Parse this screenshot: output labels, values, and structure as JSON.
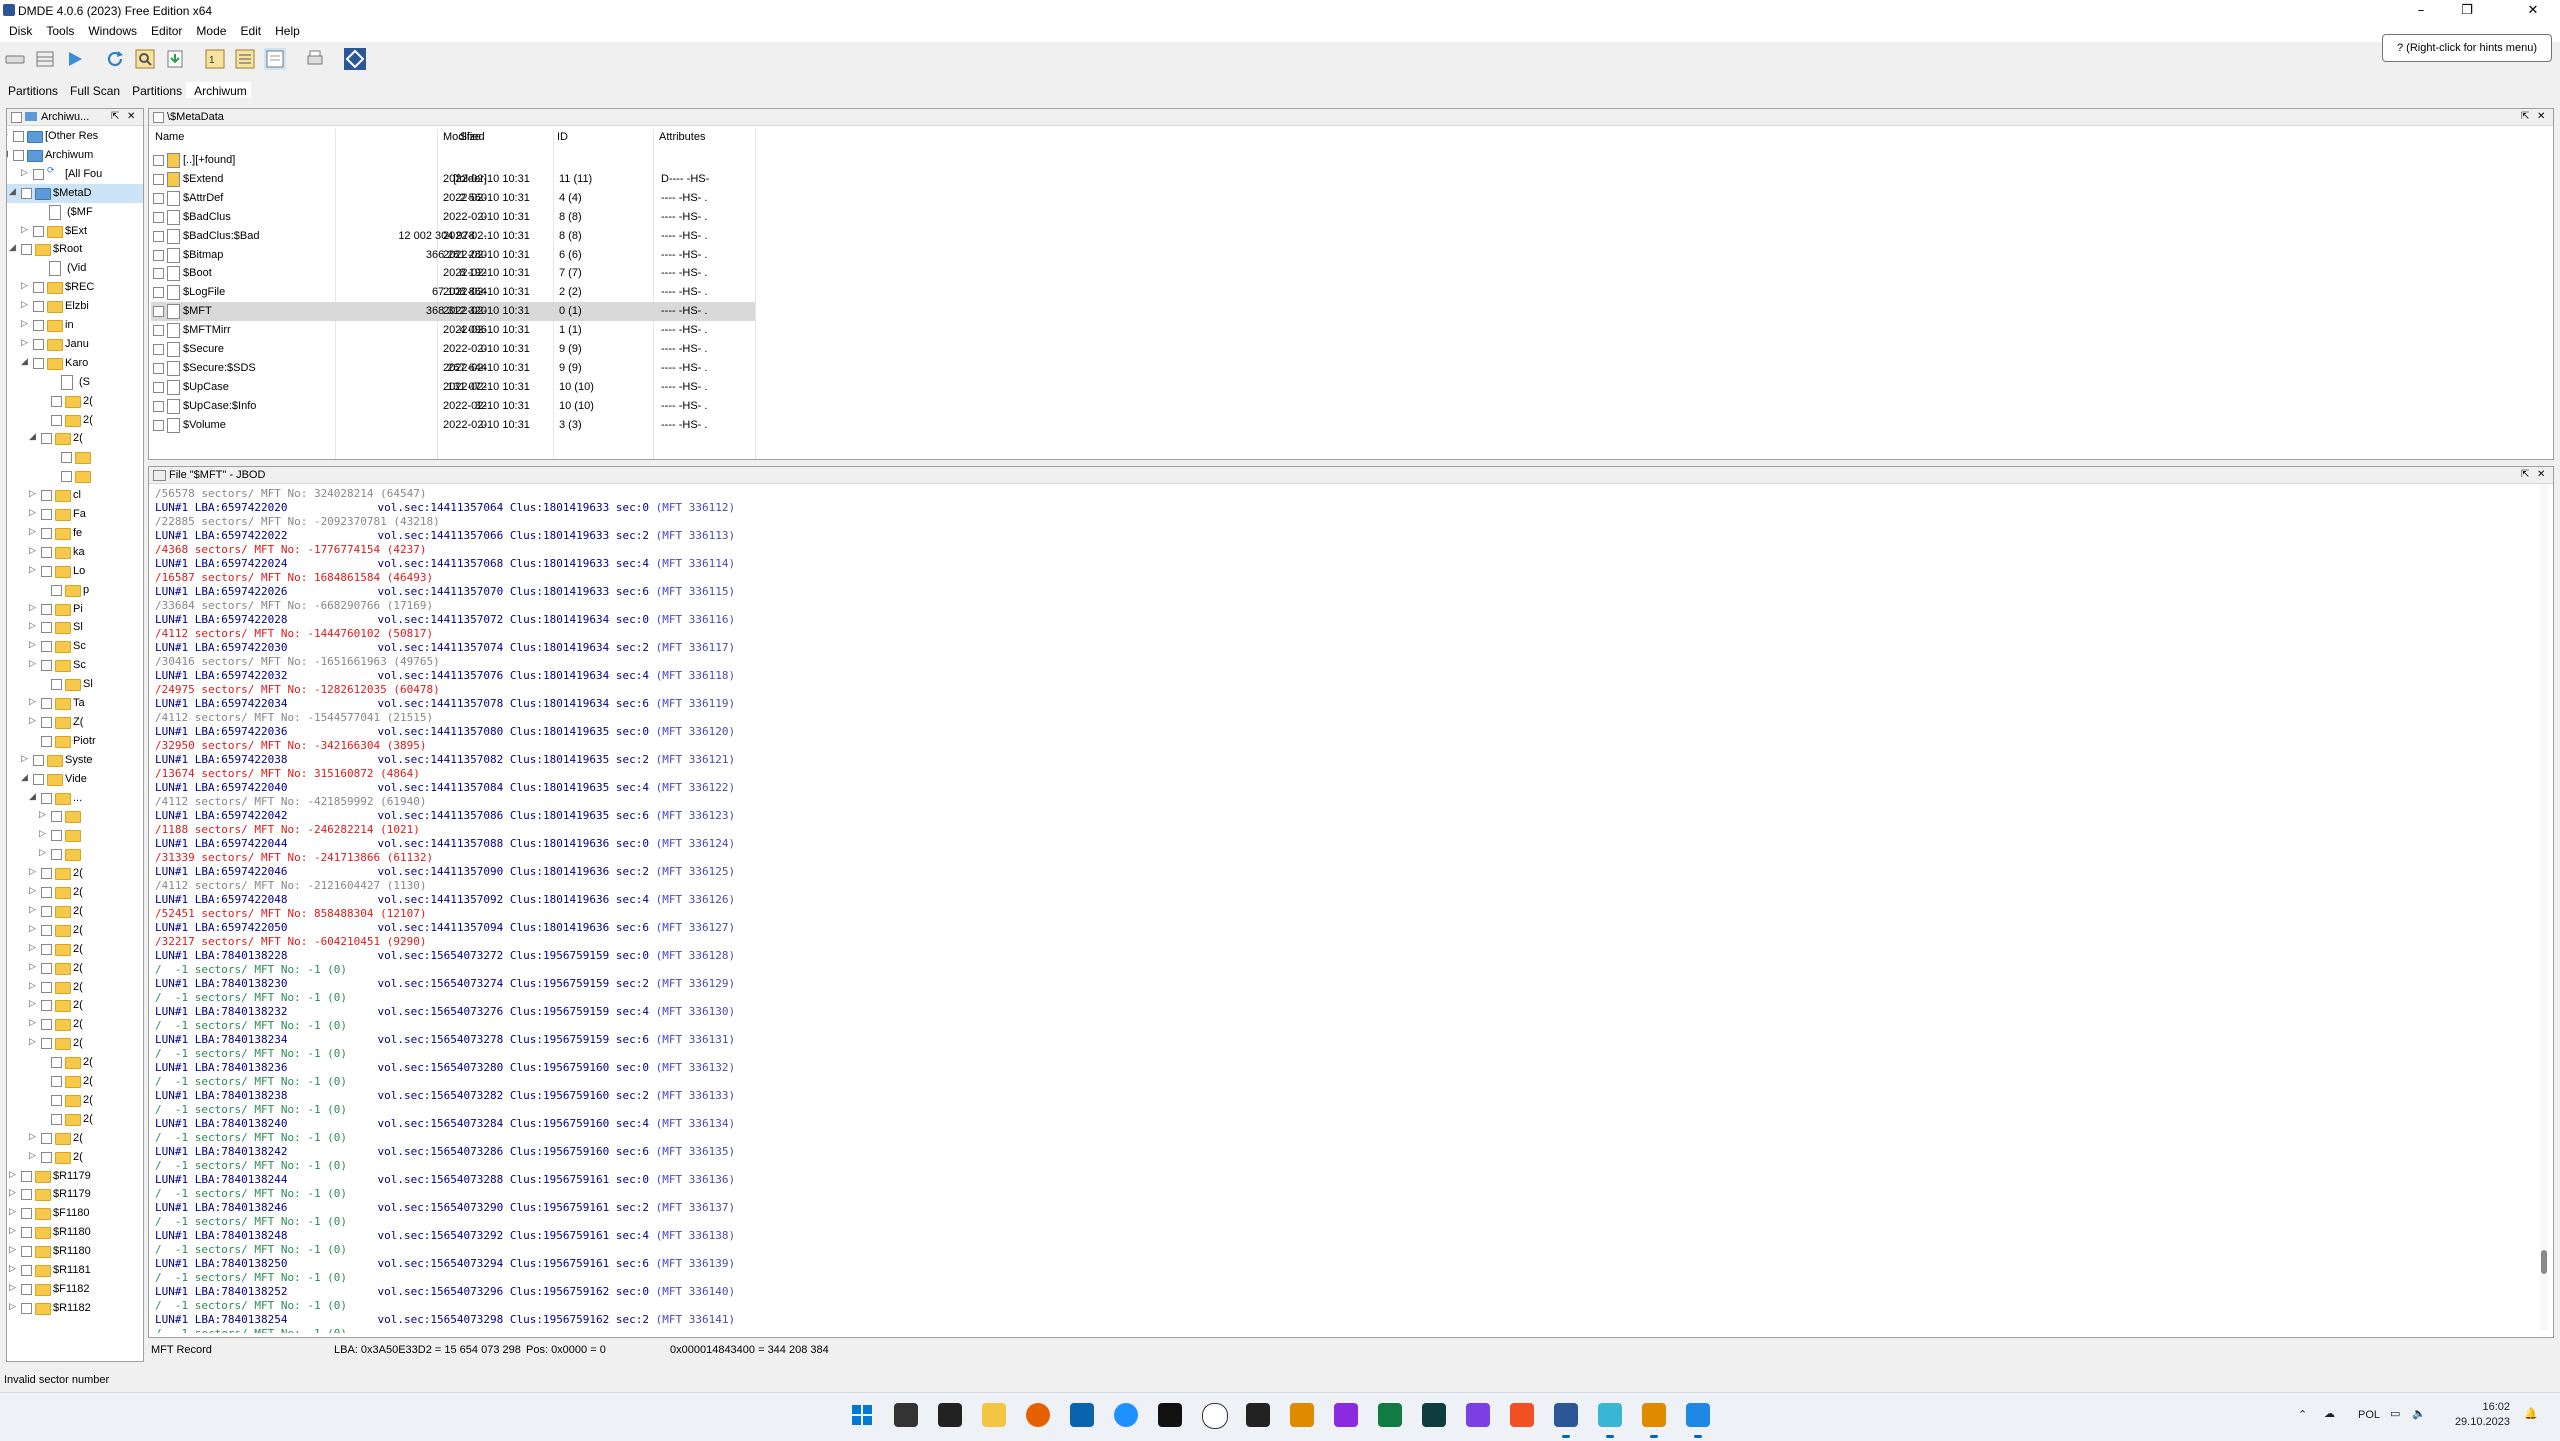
{
  "window": {
    "title": "DMDE 4.0.6 (2023) Free Edition x64",
    "minimize": "–",
    "maximize": "❐",
    "close": "✕"
  },
  "menu": [
    "Disk",
    "Tools",
    "Windows",
    "Editor",
    "Mode",
    "Edit",
    "Help"
  ],
  "hint": "? (Right-click for hints menu)",
  "tabs": [
    "Partitions",
    "Full Scan",
    "Partitions",
    "Archiwum"
  ],
  "tree": {
    "header": "Archiwu...",
    "items": [
      {
        "label": "[Other Res"
      },
      {
        "label": "Archiwum"
      },
      {
        "label": "[All Fou"
      },
      {
        "label": "$MetaD"
      },
      {
        "label": "($MF"
      },
      {
        "label": "$Ext"
      },
      {
        "label": "$Root"
      },
      {
        "label": "(Vid"
      },
      {
        "label": "$REC"
      },
      {
        "label": "Elzbi"
      },
      {
        "label": "in"
      },
      {
        "label": "Janu"
      },
      {
        "label": "Karo"
      },
      {
        "label": "(S"
      },
      {
        "label": "2("
      },
      {
        "label": "2("
      },
      {
        "label": "2("
      },
      {
        "label": ""
      },
      {
        "label": ""
      },
      {
        "label": "cl"
      },
      {
        "label": "Fa"
      },
      {
        "label": "fe"
      },
      {
        "label": "ka"
      },
      {
        "label": "Lo"
      },
      {
        "label": "p"
      },
      {
        "label": "Pi"
      },
      {
        "label": "Sl"
      },
      {
        "label": "Sc"
      },
      {
        "label": "Sc"
      },
      {
        "label": "Sl"
      },
      {
        "label": "Ta"
      },
      {
        "label": "Z("
      },
      {
        "label": "Piotr"
      },
      {
        "label": "Syste"
      },
      {
        "label": "Vide"
      },
      {
        "label": "..."
      },
      {
        "label": ""
      },
      {
        "label": ""
      },
      {
        "label": ""
      },
      {
        "label": "2("
      },
      {
        "label": "2("
      },
      {
        "label": "2("
      },
      {
        "label": "2("
      },
      {
        "label": "2("
      },
      {
        "label": "2("
      },
      {
        "label": "2("
      },
      {
        "label": "2("
      },
      {
        "label": "2("
      },
      {
        "label": "2("
      },
      {
        "label": "2("
      },
      {
        "label": "2("
      },
      {
        "label": "2("
      },
      {
        "label": "2("
      },
      {
        "label": "2("
      },
      {
        "label": "2("
      },
      {
        "label": "$R1179"
      },
      {
        "label": "$R1179"
      },
      {
        "label": "$F1180"
      },
      {
        "label": "$R1180"
      },
      {
        "label": "$R1180"
      },
      {
        "label": "$R1181"
      },
      {
        "label": "$F1182"
      },
      {
        "label": "$R1182"
      }
    ]
  },
  "file_list": {
    "header": "\\$MetaData",
    "columns": [
      "Name",
      "Size",
      "Modified",
      "ID",
      "Attributes"
    ],
    "rows": [
      {
        "name": "[..][+found]",
        "size": "",
        "modified": "",
        "id": "",
        "attr": ""
      },
      {
        "name": "$Extend",
        "size": "[folder]",
        "modified": "2022-02-10 10:31",
        "id": "11 (11)",
        "attr": "D---- -HS-"
      },
      {
        "name": "$AttrDef",
        "size": "2 560",
        "modified": "2022-02-10 10:31",
        "id": "4 (4)",
        "attr": "---- -HS- ."
      },
      {
        "name": "$BadClus",
        "size": "0",
        "modified": "2022-02-10 10:31",
        "id": "8 (8)",
        "attr": "---- -HS- ."
      },
      {
        "name": "$BadClus:$Bad",
        "size": "12 002 304 978 ...",
        "modified": "2022-02-10 10:31",
        "id": "8 (8)",
        "attr": "---- -HS- ."
      },
      {
        "name": "$Bitmap",
        "size": "366 281 280",
        "modified": "2022-02-10 10:31",
        "id": "6 (6)",
        "attr": "---- -HS- ."
      },
      {
        "name": "$Boot",
        "size": "8 192",
        "modified": "2022-02-10 10:31",
        "id": "7 (7)",
        "attr": "---- -HS- ."
      },
      {
        "name": "$LogFile",
        "size": "67 108 864",
        "modified": "2022-02-10 10:31",
        "id": "2 (2)",
        "attr": "---- -HS- ."
      },
      {
        "name": "$MFT",
        "size": "368 312 320",
        "modified": "2022-02-10 10:31",
        "id": "0 (1)",
        "attr": "---- -HS- ."
      },
      {
        "name": "$MFTMirr",
        "size": "4 096",
        "modified": "2022-02-10 10:31",
        "id": "1 (1)",
        "attr": "---- -HS- ."
      },
      {
        "name": "$Secure",
        "size": "0",
        "modified": "2022-02-10 10:31",
        "id": "9 (9)",
        "attr": "---- -HS- ."
      },
      {
        "name": "$Secure:$SDS",
        "size": "267 644",
        "modified": "2022-02-10 10:31",
        "id": "9 (9)",
        "attr": "---- -HS- ."
      },
      {
        "name": "$UpCase",
        "size": "131 072",
        "modified": "2022-02-10 10:31",
        "id": "10 (10)",
        "attr": "---- -HS- ."
      },
      {
        "name": "$UpCase:$Info",
        "size": "32",
        "modified": "2022-02-10 10:31",
        "id": "10 (10)",
        "attr": "---- -HS- ."
      },
      {
        "name": "$Volume",
        "size": "0",
        "modified": "2022-02-10 10:31",
        "id": "3 (3)",
        "attr": "---- -HS- ."
      }
    ]
  },
  "log_panel": {
    "header": "File \"$MFT\" - JBOD",
    "lines": [
      {
        "type": "gray",
        "a": "/56578 sectors/ MFT No: 324028214 (64547)",
        "b": ""
      },
      {
        "type": "lun",
        "a": "LUN#1 LBA:6597422020",
        "b": "vol.sec:14411357064 Clus:1801419633 sec:0",
        "c": "(MFT 336112)"
      },
      {
        "type": "gray",
        "a": "/22885 sectors/ MFT No: -2092370781 (43218)",
        "b": ""
      },
      {
        "type": "lun",
        "a": "LUN#1 LBA:6597422022",
        "b": "vol.sec:14411357066 Clus:1801419633 sec:2",
        "c": "(MFT 336113)"
      },
      {
        "type": "red",
        "a": "/4368 sectors/ MFT No: -1776774154 (4237)",
        "b": ""
      },
      {
        "type": "lun",
        "a": "LUN#1 LBA:6597422024",
        "b": "vol.sec:14411357068 Clus:1801419633 sec:4",
        "c": "(MFT 336114)"
      },
      {
        "type": "red",
        "a": "/16587 sectors/ MFT No: 1684861584 (46493)",
        "b": ""
      },
      {
        "type": "lun",
        "a": "LUN#1 LBA:6597422026",
        "b": "vol.sec:14411357070 Clus:1801419633 sec:6",
        "c": "(MFT 336115)"
      },
      {
        "type": "gray",
        "a": "/33684 sectors/ MFT No: -668290766 (17169)",
        "b": ""
      },
      {
        "type": "lun",
        "a": "LUN#1 LBA:6597422028",
        "b": "vol.sec:14411357072 Clus:1801419634 sec:0",
        "c": "(MFT 336116)"
      },
      {
        "type": "red",
        "a": "/4112 sectors/ MFT No: -1444760102 (50817)",
        "b": ""
      },
      {
        "type": "lun",
        "a": "LUN#1 LBA:6597422030",
        "b": "vol.sec:14411357074 Clus:1801419634 sec:2",
        "c": "(MFT 336117)"
      },
      {
        "type": "gray",
        "a": "/30416 sectors/ MFT No: -1651661963 (49765)",
        "b": ""
      },
      {
        "type": "lun",
        "a": "LUN#1 LBA:6597422032",
        "b": "vol.sec:14411357076 Clus:1801419634 sec:4",
        "c": "(MFT 336118)"
      },
      {
        "type": "red",
        "a": "/24975 sectors/ MFT No: -1282612035 (60478)",
        "b": ""
      },
      {
        "type": "lun",
        "a": "LUN#1 LBA:6597422034",
        "b": "vol.sec:14411357078 Clus:1801419634 sec:6",
        "c": "(MFT 336119)"
      },
      {
        "type": "gray",
        "a": "/4112 sectors/ MFT No: -1544577041 (21515)",
        "b": ""
      },
      {
        "type": "lun",
        "a": "LUN#1 LBA:6597422036",
        "b": "vol.sec:14411357080 Clus:1801419635 sec:0",
        "c": "(MFT 336120)"
      },
      {
        "type": "red",
        "a": "/32950 sectors/ MFT No: -342166304 (3895)",
        "b": ""
      },
      {
        "type": "lun",
        "a": "LUN#1 LBA:6597422038",
        "b": "vol.sec:14411357082 Clus:1801419635 sec:2",
        "c": "(MFT 336121)"
      },
      {
        "type": "red",
        "a": "/13674 sectors/ MFT No: 315160872 (4864)",
        "b": ""
      },
      {
        "type": "lun",
        "a": "LUN#1 LBA:6597422040",
        "b": "vol.sec:14411357084 Clus:1801419635 sec:4",
        "c": "(MFT 336122)"
      },
      {
        "type": "gray",
        "a": "/4112 sectors/ MFT No: -421859992 (61940)",
        "b": ""
      },
      {
        "type": "lun",
        "a": "LUN#1 LBA:6597422042",
        "b": "vol.sec:14411357086 Clus:1801419635 sec:6",
        "c": "(MFT 336123)"
      },
      {
        "type": "red",
        "a": "/1188 sectors/ MFT No: -246282214 (1021)",
        "b": ""
      },
      {
        "type": "lun",
        "a": "LUN#1 LBA:6597422044",
        "b": "vol.sec:14411357088 Clus:1801419636 sec:0",
        "c": "(MFT 336124)"
      },
      {
        "type": "red",
        "a": "/31339 sectors/ MFT No: -241713866 (61132)",
        "b": ""
      },
      {
        "type": "lun",
        "a": "LUN#1 LBA:6597422046",
        "b": "vol.sec:14411357090 Clus:1801419636 sec:2",
        "c": "(MFT 336125)"
      },
      {
        "type": "gray",
        "a": "/4112 sectors/ MFT No: -2121604427 (1130)",
        "b": ""
      },
      {
        "type": "lun",
        "a": "LUN#1 LBA:6597422048",
        "b": "vol.sec:14411357092 Clus:1801419636 sec:4",
        "c": "(MFT 336126)"
      },
      {
        "type": "red",
        "a": "/52451 sectors/ MFT No: 858488304 (12107)",
        "b": ""
      },
      {
        "type": "lun",
        "a": "LUN#1 LBA:6597422050",
        "b": "vol.sec:14411357094 Clus:1801419636 sec:6",
        "c": "(MFT 336127)"
      },
      {
        "type": "red",
        "a": "/32217 sectors/ MFT No: -604210451 (9290)",
        "b": ""
      },
      {
        "type": "lun",
        "a": "LUN#1 LBA:7840138228",
        "b": "vol.sec:15654073272 Clus:1956759159 sec:0",
        "c": "(MFT 336128)"
      },
      {
        "type": "green",
        "a": "/  -1 sectors/ MFT No: -1 (0)",
        "b": ""
      },
      {
        "type": "lun",
        "a": "LUN#1 LBA:7840138230",
        "b": "vol.sec:15654073274 Clus:1956759159 sec:2",
        "c": "(MFT 336129)"
      },
      {
        "type": "green",
        "a": "/  -1 sectors/ MFT No: -1 (0)",
        "b": ""
      },
      {
        "type": "lun",
        "a": "LUN#1 LBA:7840138232",
        "b": "vol.sec:15654073276 Clus:1956759159 sec:4",
        "c": "(MFT 336130)"
      },
      {
        "type": "green",
        "a": "/  -1 sectors/ MFT No: -1 (0)",
        "b": ""
      },
      {
        "type": "lun",
        "a": "LUN#1 LBA:7840138234",
        "b": "vol.sec:15654073278 Clus:1956759159 sec:6",
        "c": "(MFT 336131)"
      },
      {
        "type": "green",
        "a": "/  -1 sectors/ MFT No: -1 (0)",
        "b": ""
      },
      {
        "type": "lun",
        "a": "LUN#1 LBA:7840138236",
        "b": "vol.sec:15654073280 Clus:1956759160 sec:0",
        "c": "(MFT 336132)"
      },
      {
        "type": "green",
        "a": "/  -1 sectors/ MFT No: -1 (0)",
        "b": ""
      },
      {
        "type": "lun",
        "a": "LUN#1 LBA:7840138238",
        "b": "vol.sec:15654073282 Clus:1956759160 sec:2",
        "c": "(MFT 336133)"
      },
      {
        "type": "green",
        "a": "/  -1 sectors/ MFT No: -1 (0)",
        "b": ""
      },
      {
        "type": "lun",
        "a": "LUN#1 LBA:7840138240",
        "b": "vol.sec:15654073284 Clus:1956759160 sec:4",
        "c": "(MFT 336134)"
      },
      {
        "type": "green",
        "a": "/  -1 sectors/ MFT No: -1 (0)",
        "b": ""
      },
      {
        "type": "lun",
        "a": "LUN#1 LBA:7840138242",
        "b": "vol.sec:15654073286 Clus:1956759160 sec:6",
        "c": "(MFT 336135)"
      },
      {
        "type": "green",
        "a": "/  -1 sectors/ MFT No: -1 (0)",
        "b": ""
      },
      {
        "type": "lun",
        "a": "LUN#1 LBA:7840138244",
        "b": "vol.sec:15654073288 Clus:1956759161 sec:0",
        "c": "(MFT 336136)"
      },
      {
        "type": "green",
        "a": "/  -1 sectors/ MFT No: -1 (0)",
        "b": ""
      },
      {
        "type": "lun",
        "a": "LUN#1 LBA:7840138246",
        "b": "vol.sec:15654073290 Clus:1956759161 sec:2",
        "c": "(MFT 336137)"
      },
      {
        "type": "green",
        "a": "/  -1 sectors/ MFT No: -1 (0)",
        "b": ""
      },
      {
        "type": "lun",
        "a": "LUN#1 LBA:7840138248",
        "b": "vol.sec:15654073292 Clus:1956759161 sec:4",
        "c": "(MFT 336138)"
      },
      {
        "type": "green",
        "a": "/  -1 sectors/ MFT No: -1 (0)",
        "b": ""
      },
      {
        "type": "lun",
        "a": "LUN#1 LBA:7840138250",
        "b": "vol.sec:15654073294 Clus:1956759161 sec:6",
        "c": "(MFT 336139)"
      },
      {
        "type": "green",
        "a": "/  -1 sectors/ MFT No: -1 (0)",
        "b": ""
      },
      {
        "type": "lun",
        "a": "LUN#1 LBA:7840138252",
        "b": "vol.sec:15654073296 Clus:1956759162 sec:0",
        "c": "(MFT 336140)"
      },
      {
        "type": "green",
        "a": "/  -1 sectors/ MFT No: -1 (0)",
        "b": ""
      },
      {
        "type": "lun",
        "a": "LUN#1 LBA:7840138254",
        "b": "vol.sec:15654073298 Clus:1956759162 sec:2",
        "c": "(MFT 336141)"
      },
      {
        "type": "green",
        "a": "/  -1 sectors/ MFT No: -1 (0)",
        "b": ""
      }
    ]
  },
  "record_status": {
    "type": "MFT Record",
    "lba": "LBA: 0x3A50E33D2 = 15 654 073 298",
    "pos": "Pos: 0x0000 = 0",
    "offset": "0x000014843400 = 344 208 384"
  },
  "status_text": "Invalid sector number",
  "tray": {
    "language": "POL",
    "time": "16:02",
    "date": "29.10.2023"
  },
  "colors": {
    "lun_text": "#00008b",
    "gray_text": "#888888",
    "red_text": "#e01a1a",
    "green_text": "#2e8b57",
    "selection": "#cce4f7"
  }
}
